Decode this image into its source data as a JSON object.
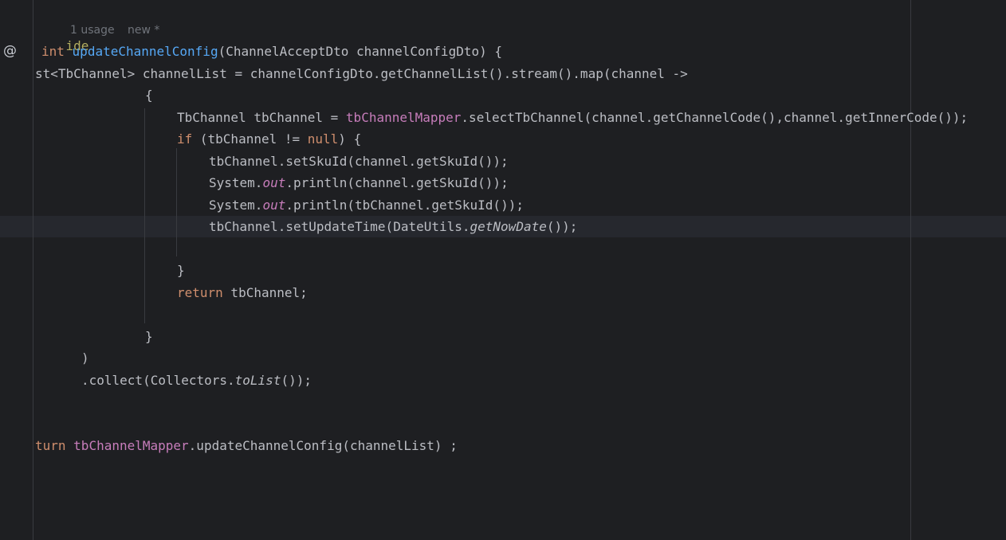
{
  "code": {
    "l1_annotation": "ide",
    "usage_hint": "1 usage",
    "author_hint": "new *",
    "l2_kw": "int",
    "l2_method": "updateChannelConfig",
    "l2_rest": "(ChannelAcceptDto channelConfigDto) {",
    "l3": "st<TbChannel> channelList = channelConfigDto.getChannelList().stream().map(channel ->",
    "l4": "{",
    "l5_a": "TbChannel tbChannel = ",
    "l5_field": "tbChannelMapper",
    "l5_b": ".selectTbChannel(channel.getChannelCode(),channel.getInnerCode());",
    "l6_kw": "if",
    "l6_a": " (tbChannel != ",
    "l6_null": "null",
    "l6_b": ") {",
    "l7": "tbChannel.setSkuId(channel.getSkuId());",
    "l8_a": "System.",
    "l8_out": "out",
    "l8_b": ".println(channel.getSkuId());",
    "l9_a": "System.",
    "l9_out": "out",
    "l9_b": ".println(tbChannel.getSkuId());",
    "l10_a": "tbChannel.setUpdateTime(DateUtils.",
    "l10_call": "getNowDate",
    "l10_b": "());",
    "l11": "}",
    "l12_kw": "return",
    "l12_rest": " tbChannel;",
    "l13": "}",
    "l14": ")",
    "l15_a": ".collect(Collectors.",
    "l15_call": "toList",
    "l15_b": "());",
    "l16_kw": "turn",
    "l16_field": "tbChannelMapper",
    "l16_rest": ".updateChannelConfig(channelList) ;"
  },
  "gutter": {
    "override_icon": "at-sign-icon",
    "override_glyph": "@"
  },
  "colors": {
    "background": "#1e1f22",
    "keyword": "#cf8e6d",
    "method_declaration": "#56a8f5",
    "field": "#c77dbb",
    "annotation": "#b3ae60",
    "text": "#bcbec4"
  }
}
